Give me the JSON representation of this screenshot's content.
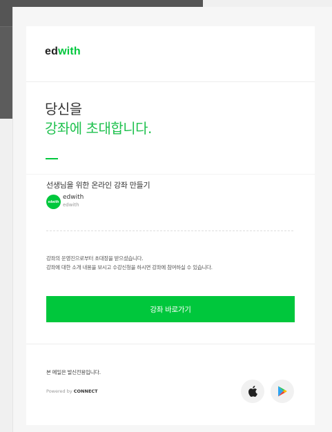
{
  "header": {
    "logo_part1": "ed",
    "logo_part2": "with"
  },
  "hero": {
    "line1": "당신을",
    "line2": "강좌에 초대합니다."
  },
  "course": {
    "title": "선생님을 위한 온라인 강좌 만들기",
    "avatar_text": "edwith",
    "author_name": "edwith",
    "author_sub": "edwith"
  },
  "message": {
    "line1": "강좌의 운영진으로부터 초대장을 받으셨습니다.",
    "line2": "강좌에 대한 소개 내용을 보시고 수강신청을 하시면 강좌에 참여하실 수 있습니다."
  },
  "cta": {
    "label": "강좌 바로가기"
  },
  "footer": {
    "note": "본 메일은 발신전용입니다.",
    "powered_prefix": "Powered by",
    "powered_brand": "CONNECT"
  },
  "icons": {
    "apple": "apple-icon",
    "play": "google-play-icon"
  },
  "colors": {
    "brand_green": "#00c73c",
    "title_green": "#1fc14e"
  }
}
